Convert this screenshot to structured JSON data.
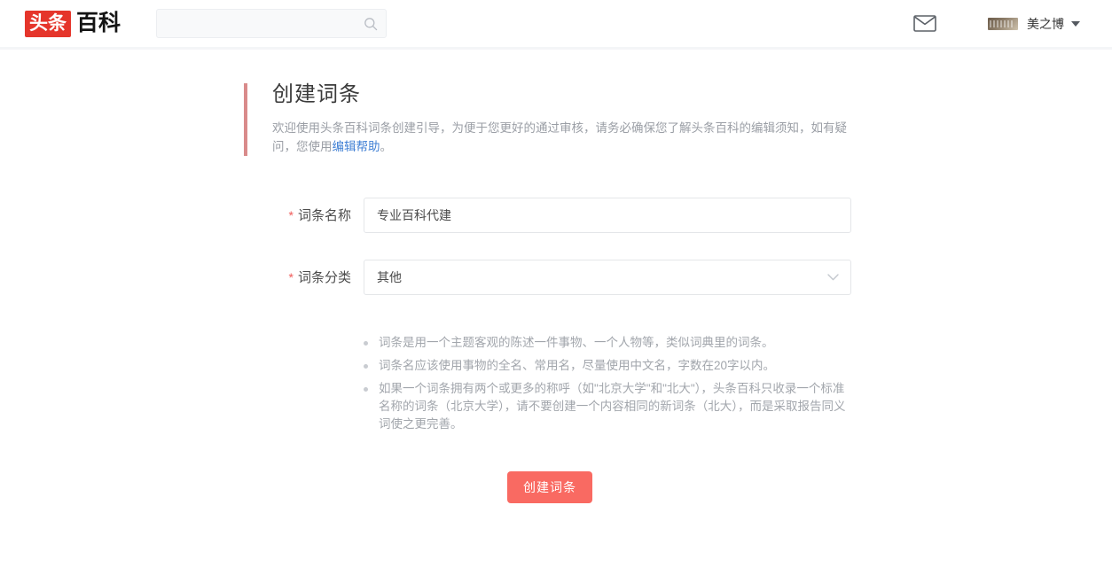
{
  "header": {
    "logo": {
      "badge_text": "头条",
      "badge_color": "#e5352b",
      "word_text": "百科"
    },
    "search": {
      "value": "",
      "placeholder": "",
      "icon": "search-icon"
    },
    "mail_icon": "envelope-icon",
    "user": {
      "name": "美之博",
      "avatar": "user-avatar-image",
      "caret": "chevron-down-icon"
    }
  },
  "main": {
    "title": "创建词条",
    "intro_prefix": "欢迎使用头条百科词条创建引导，为便于您更好的通过审核，请务必确保您了解头条百科的编辑须知，如有疑问，您使用",
    "intro_link": "编辑帮助",
    "intro_suffix": "。",
    "accent_color": "#d98b8b",
    "form": {
      "fields": [
        {
          "label": "词条名称",
          "required_mark": "*",
          "value": "专业百科代建",
          "placeholder": "",
          "type": "text"
        },
        {
          "label": "词条分类",
          "required_mark": "*",
          "value": "其他",
          "type": "select",
          "caret": "chevron-down-icon"
        }
      ]
    },
    "tips": [
      "词条是用一个主题客观的陈述一件事物、一个人物等，类似词典里的词条。",
      "词条名应该使用事物的全名、常用名，尽量使用中文名，字数在20字以内。",
      "如果一个词条拥有两个或更多的称呼（如\"北京大学\"和\"北大\"），头条百科只收录一个标准名称的词条（北京大学），请不要创建一个内容相同的新词条（北大），而是采取报告同义词使之更完善。"
    ],
    "submit_label": "创建词条",
    "submit_color": "#f96a62"
  }
}
